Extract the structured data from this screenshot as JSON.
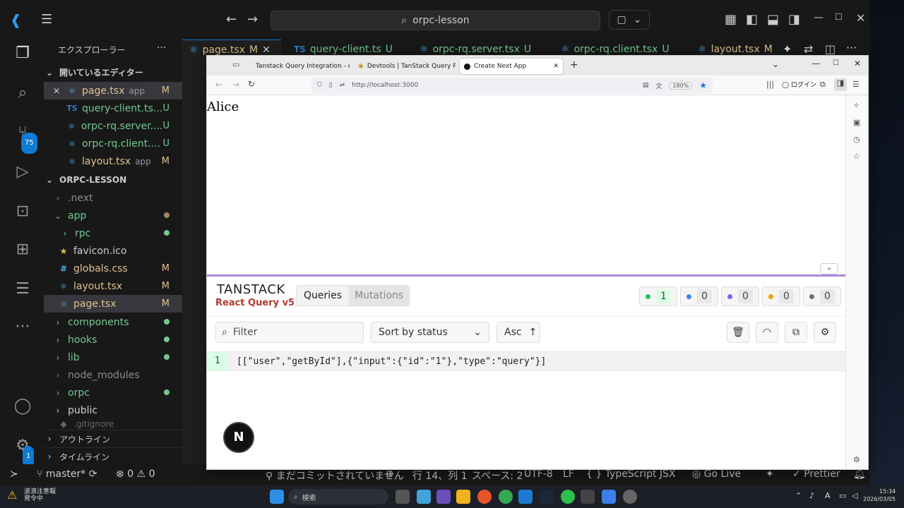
{
  "titlebar": {
    "search_text": "orpc-lesson"
  },
  "activity": {
    "scm_badge": "75",
    "settings_badge": "1"
  },
  "sidebar": {
    "title": "エクスプローラー",
    "more": "···",
    "open_editors_header": "開いているエディター",
    "open_editors": [
      {
        "name": "page.tsx",
        "hint": "app",
        "status": "M"
      },
      {
        "name": "query-client.ts...",
        "hint": "",
        "status": "U"
      },
      {
        "name": "orpc-rq.server....",
        "hint": "",
        "status": "U"
      },
      {
        "name": "orpc-rq.client....",
        "hint": "",
        "status": "U"
      },
      {
        "name": "layout.tsx",
        "hint": "app",
        "status": "M"
      }
    ],
    "project_header": "ORPC-LESSON",
    "tree": [
      {
        "name": ".next",
        "status": ""
      },
      {
        "name": "app",
        "status": ""
      },
      {
        "name": "rpc",
        "status": ""
      },
      {
        "name": "favicon.ico",
        "status": ""
      },
      {
        "name": "globals.css",
        "status": "M"
      },
      {
        "name": "layout.tsx",
        "status": "M"
      },
      {
        "name": "page.tsx",
        "status": "M"
      },
      {
        "name": "components",
        "status": ""
      },
      {
        "name": "hooks",
        "status": ""
      },
      {
        "name": "lib",
        "status": ""
      },
      {
        "name": "node_modules",
        "status": ""
      },
      {
        "name": "orpc",
        "status": ""
      },
      {
        "name": "public",
        "status": ""
      },
      {
        "name": ".gitignore",
        "status": ""
      }
    ],
    "outline": "アウトライン",
    "timeline": "タイムライン"
  },
  "editor_tabs": [
    {
      "name": "page.tsx",
      "status": "M"
    },
    {
      "name": "query-client.ts",
      "status": "U"
    },
    {
      "name": "orpc-rq.server.tsx",
      "status": "U"
    },
    {
      "name": "orpc-rq.client.tsx",
      "status": "U"
    },
    {
      "name": "layout.tsx",
      "status": "M"
    }
  ],
  "statusbar": {
    "branch": "master*",
    "errors": "0",
    "warnings": "0",
    "commit": "まだコミットされていません",
    "position": "行 14、列 1",
    "spaces": "スペース: 2",
    "encoding": "UTF-8",
    "eol": "LF",
    "lang": "TypeScript JSX",
    "golive": "Go Live",
    "prettier": "Prettier"
  },
  "browser": {
    "tabs": [
      "Tanstack Query Integration - oR",
      "Devtools | TanStack Query Reac",
      "Create Next App"
    ],
    "url": "http://localhost:3000",
    "zoom": "180%",
    "login": "ログイン",
    "page_text": "Alice"
  },
  "devtools": {
    "brand": "TANSTACK",
    "sub": "React Query v5",
    "tab_queries": "Queries",
    "tab_mutations": "Mutations",
    "counts": [
      {
        "value": "1",
        "color": "#22c55e"
      },
      {
        "value": "0",
        "color": "#3b82f6"
      },
      {
        "value": "0",
        "color": "#8b5cf6"
      },
      {
        "value": "0",
        "color": "#f59e0b"
      },
      {
        "value": "0",
        "color": "#6b7280"
      }
    ],
    "filter_placeholder": "Filter",
    "sort": "Sort by status",
    "order": "Asc",
    "query_count": "1",
    "query_key": "[[\"user\",\"getById\"],{\"input\":{\"id\":\"1\"},\"type\":\"query\"}]"
  },
  "taskbar": {
    "search": "検索",
    "weather_line1": "波浪注意報",
    "weather_line2": "発令中",
    "time": "15:34",
    "date": "2026/03/05"
  }
}
